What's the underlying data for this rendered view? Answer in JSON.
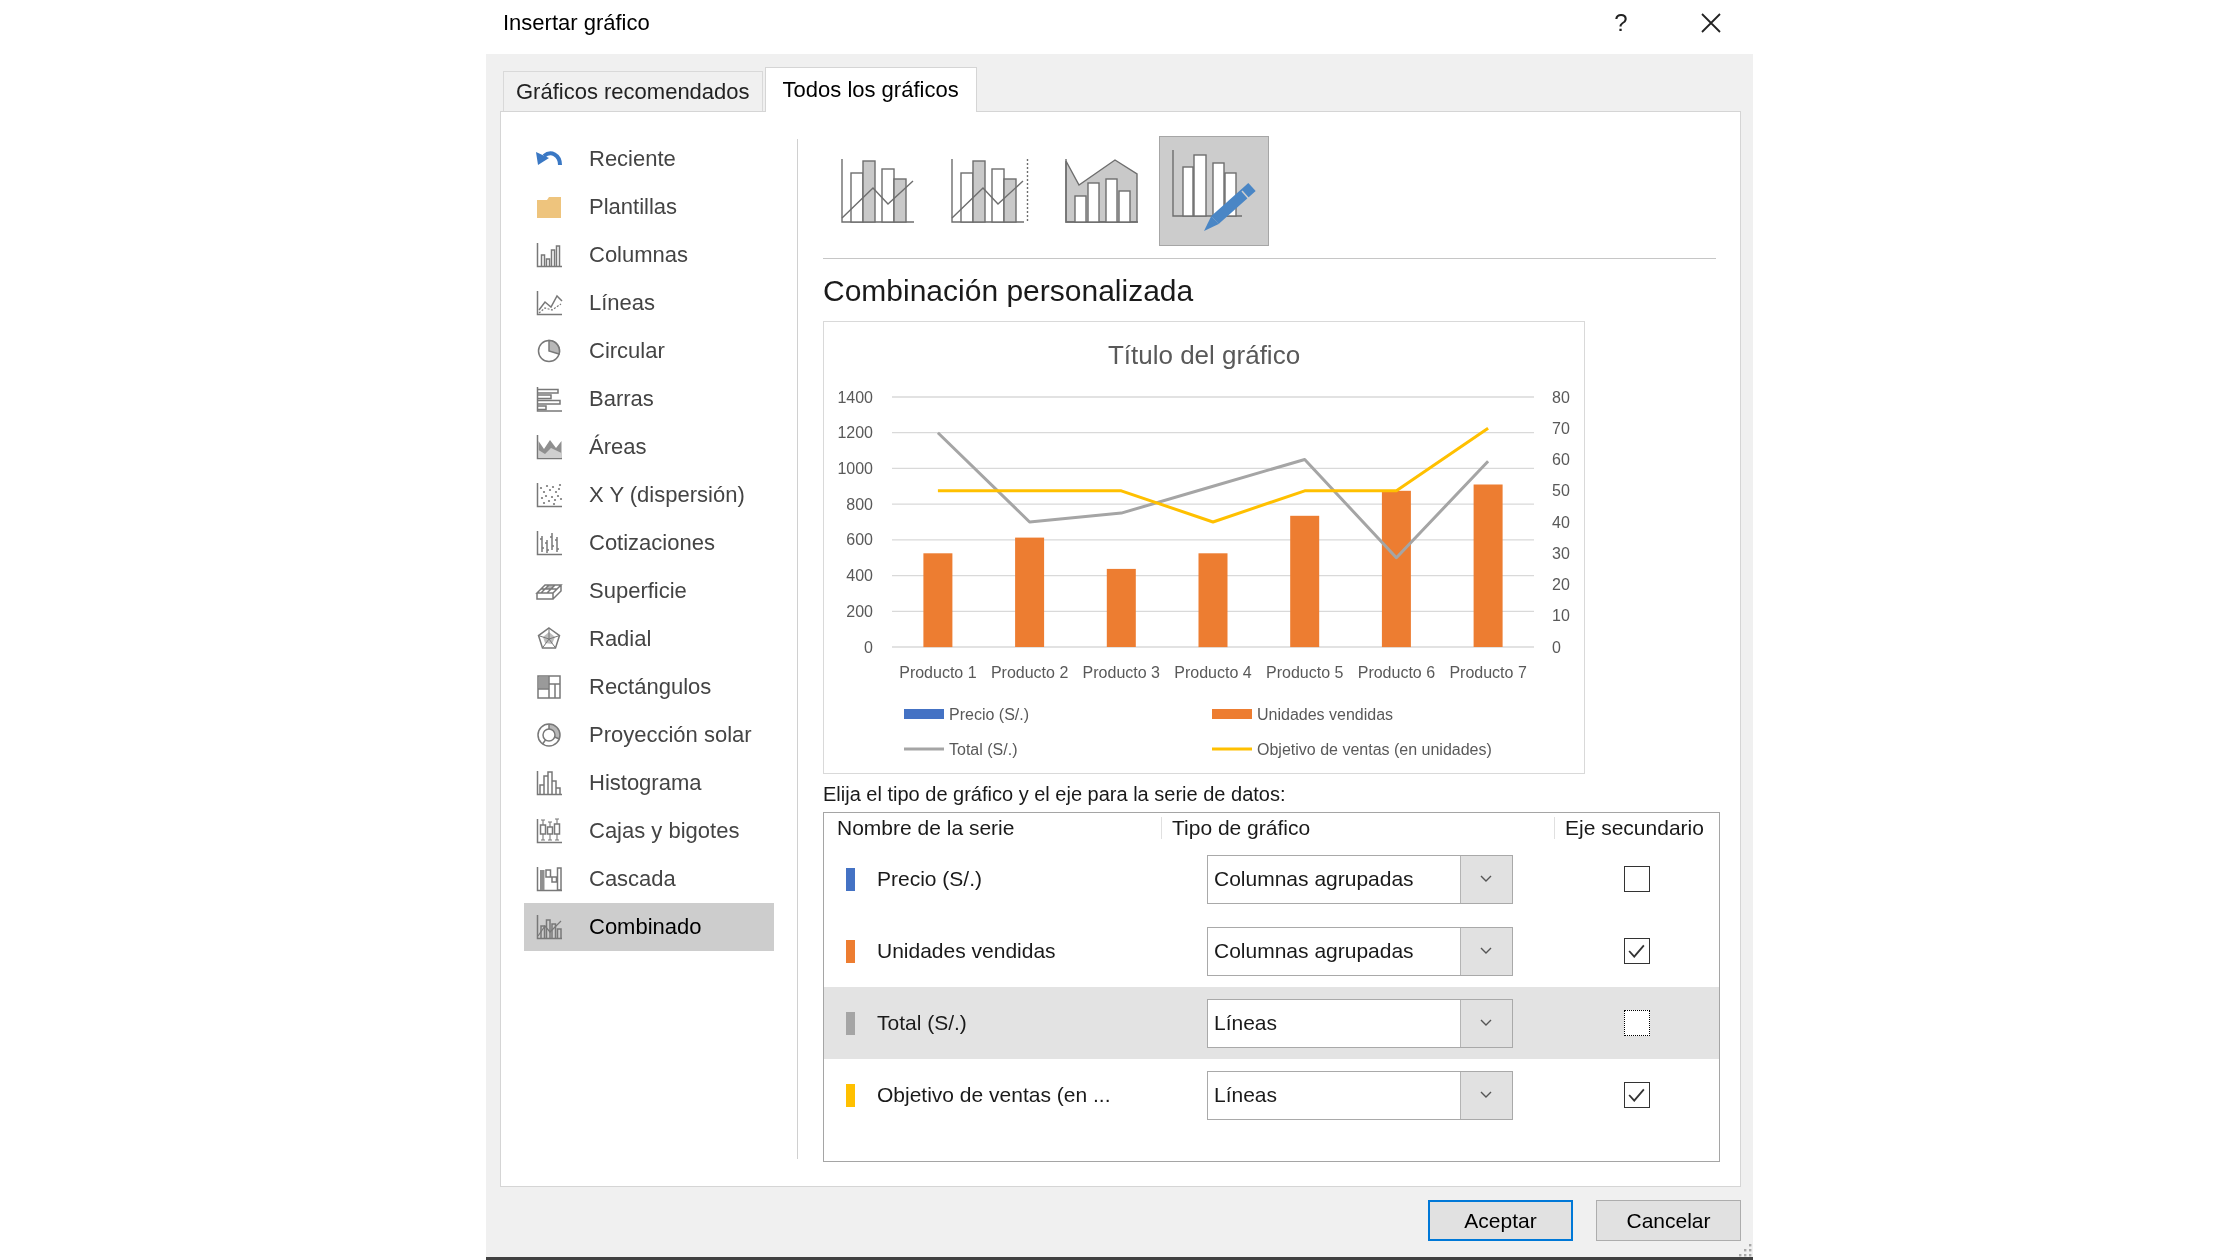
{
  "window": {
    "title": "Insertar gráfico",
    "help_label": "?"
  },
  "tabs": [
    {
      "label": "Gráficos recomendados",
      "selected": false
    },
    {
      "label": "Todos los gráficos",
      "selected": true
    }
  ],
  "sidebar": {
    "items": [
      {
        "label": "Reciente",
        "selected": false
      },
      {
        "label": "Plantillas",
        "selected": false
      },
      {
        "label": "Columnas",
        "selected": false
      },
      {
        "label": "Líneas",
        "selected": false
      },
      {
        "label": "Circular",
        "selected": false
      },
      {
        "label": "Barras",
        "selected": false
      },
      {
        "label": "Áreas",
        "selected": false
      },
      {
        "label": "X Y (dispersión)",
        "selected": false
      },
      {
        "label": "Cotizaciones",
        "selected": false
      },
      {
        "label": "Superficie",
        "selected": false
      },
      {
        "label": "Radial",
        "selected": false
      },
      {
        "label": "Rectángulos",
        "selected": false
      },
      {
        "label": "Proyección solar",
        "selected": false
      },
      {
        "label": "Histograma",
        "selected": false
      },
      {
        "label": "Cajas y bigotes",
        "selected": false
      },
      {
        "label": "Cascada",
        "selected": false
      },
      {
        "label": "Combinado",
        "selected": true
      }
    ]
  },
  "chart_variants": [
    {
      "selected": false
    },
    {
      "selected": false
    },
    {
      "selected": false
    },
    {
      "selected": true
    }
  ],
  "section_title": "Combinación personalizada",
  "preview": {
    "chart_data": {
      "type": "bar",
      "title": "Título del gráfico",
      "categories": [
        "Producto 1",
        "Producto 2",
        "Producto 3",
        "Producto 4",
        "Producto 5",
        "Producto 6",
        "Producto 7"
      ],
      "ylim": [
        0,
        1400
      ],
      "yticks": [
        0,
        200,
        400,
        600,
        800,
        1000,
        1200,
        1400
      ],
      "y2lim": [
        0,
        80
      ],
      "y2ticks": [
        0,
        10,
        20,
        30,
        40,
        50,
        60,
        70,
        80
      ],
      "grid": true,
      "legend": "bottom",
      "series": [
        {
          "name": "Precio (S/.)",
          "color": "#4472c4",
          "values": [
            null,
            null,
            null,
            null,
            null,
            null,
            null
          ]
        },
        {
          "name": "Unidades vendidas",
          "color": "#ed7d31",
          "axis": "y2",
          "values": [
            30,
            35,
            25,
            30,
            42,
            50,
            52
          ]
        },
        {
          "name": "Total (S/.)",
          "color": "#a5a5a5",
          "type": "line",
          "values": [
            1200,
            700,
            750,
            900,
            1050,
            500,
            1040
          ]
        },
        {
          "name": "Objetivo de ventas (en unidades)",
          "color": "#ffc000",
          "type": "line",
          "axis": "y2",
          "values": [
            50,
            50,
            50,
            40,
            50,
            50,
            70
          ]
        }
      ]
    }
  },
  "series_prompt": "Elija el tipo de gráfico y el eje para la serie de datos:",
  "series_table": {
    "columns": [
      "Nombre de la serie",
      "Tipo de gráfico",
      "Eje secundario"
    ],
    "rows": [
      {
        "name": "Precio (S/.)",
        "color": "#4472c4",
        "chart_type": "Columnas agrupadas",
        "secondary_axis": false,
        "selected": false
      },
      {
        "name": "Unidades vendidas",
        "color": "#ed7d31",
        "chart_type": "Columnas agrupadas",
        "secondary_axis": true,
        "selected": false
      },
      {
        "name": "Total (S/.)",
        "color": "#a5a5a5",
        "chart_type": "Líneas",
        "secondary_axis": false,
        "selected": true
      },
      {
        "name": "Objetivo de ventas (en ...",
        "color": "#ffc000",
        "chart_type": "Líneas",
        "secondary_axis": true,
        "selected": false
      }
    ]
  },
  "buttons": [
    {
      "label": "Aceptar",
      "default": true
    },
    {
      "label": "Cancelar",
      "default": false
    }
  ]
}
